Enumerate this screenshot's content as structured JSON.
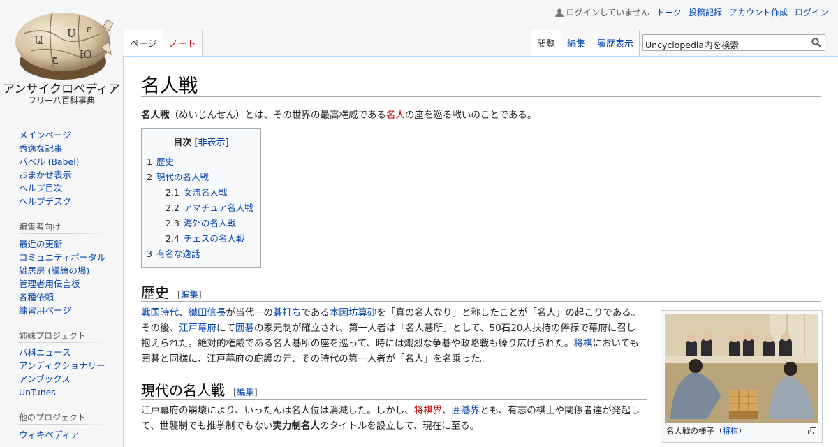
{
  "logo": {
    "name": "アンサイクロペディア",
    "tagline": "フリー八百科事典"
  },
  "personal": {
    "not_logged_in": "ログインしていません",
    "talk": "トーク",
    "contribs": "投稿記録",
    "create_account": "アカウント作成",
    "login": "ログイン"
  },
  "tabs": {
    "left": [
      {
        "label": "ページ",
        "selected": true
      },
      {
        "label": "ノート",
        "selected": false
      }
    ],
    "right": [
      {
        "label": "閲覧",
        "selected": true
      },
      {
        "label": "編集"
      },
      {
        "label": "履歴表示"
      }
    ]
  },
  "search": {
    "placeholder": "Uncyclopedia内を検索"
  },
  "article": {
    "title": "名人戦",
    "intro": {
      "bold": "名人戦",
      "t1": "（めいじんせん）とは、その世界の最高権威である",
      "link": "名人",
      "t2": "の座を巡る戦いのことである。"
    },
    "toc": {
      "title": "目次",
      "toggle_open": "[",
      "toggle": "非表示",
      "toggle_close": "]",
      "items": [
        {
          "num": "1",
          "label": "歴史"
        },
        {
          "num": "2",
          "label": "現代の名人戦"
        },
        {
          "num": "2.1",
          "label": "女流名人戦"
        },
        {
          "num": "2.2",
          "label": "アマチュア名人戦"
        },
        {
          "num": "2.3",
          "label": "海外の名人戦"
        },
        {
          "num": "2.4",
          "label": "チェスの名人戦"
        },
        {
          "num": "3",
          "label": "有名な逸話"
        }
      ]
    },
    "edit_open": "[",
    "edit_label": "編集",
    "edit_close": "]",
    "history": {
      "heading": "歴史",
      "l_sengoku": "戦国時代",
      "c1": "、",
      "l_nobunaga": "織田信長",
      "t1": "が当代一の",
      "l_goshi": "碁打ち",
      "t2": "である",
      "l_sansa": "本因坊算砂",
      "t3": "を「真の名人なり」と称したことが「名人」の起こりである。その後、",
      "l_edo": "江戸幕府",
      "t4": "にて",
      "l_igo": "囲碁",
      "t5": "の家元制が確立され、第一人者は「名人碁所」として、50石20人扶持の俸禄で幕府に召し抱えられた。絶対的権威である名人碁所の座を巡って、時には熾烈な争碁や政略戦も繰り広げられた。",
      "l_shogi": "将棋",
      "t6": "においても囲碁と同様に、江戸幕府の庇護の元、その時代の第一人者が「名人」を名乗った。"
    },
    "modern": {
      "heading": "現代の名人戦",
      "t1": "江戸幕府の崩壊により、いったんは名人位は消滅した。しかし、",
      "l_shogikai": "将棋界",
      "c1": "、",
      "l_igokai": "囲碁界",
      "t2": "とも、有志の棋士や関係者達が発起して、世襲制でも推挙制でもない",
      "bold": "実力制名人",
      "t3": "のタイトルを設立して、現在に至る。"
    },
    "thumb": {
      "caption": "名人戦の様子（",
      "link": "将棋",
      "caption_end": "）"
    }
  },
  "sidebar": {
    "nav": [
      "メインページ",
      "秀逸な記事",
      "バベル (Babel)",
      "おまかせ表示",
      "ヘルプ目次",
      "ヘルプデスク"
    ],
    "editors_heading": "編集者向け",
    "editors": [
      "最近の更新",
      "コミュニティポータル",
      "雑居房 (議論の場)",
      "管理者用伝言板",
      "各種依頼",
      "練習用ページ"
    ],
    "sister_heading": "姉妹プロジェクト",
    "sister": [
      "バ科ニュース",
      "アンディクショナリー",
      "アンブックス",
      "UnTunes"
    ],
    "other_heading": "他のプロジェクト",
    "other": [
      "ウィキペディア"
    ]
  },
  "colors": {
    "link": "#0645ad",
    "redlink": "#ba0000",
    "border": "#a7d7f9"
  },
  "icons": [
    "puzzle-globe-logo",
    "user-icon",
    "search-icon",
    "enlarge-icon"
  ]
}
